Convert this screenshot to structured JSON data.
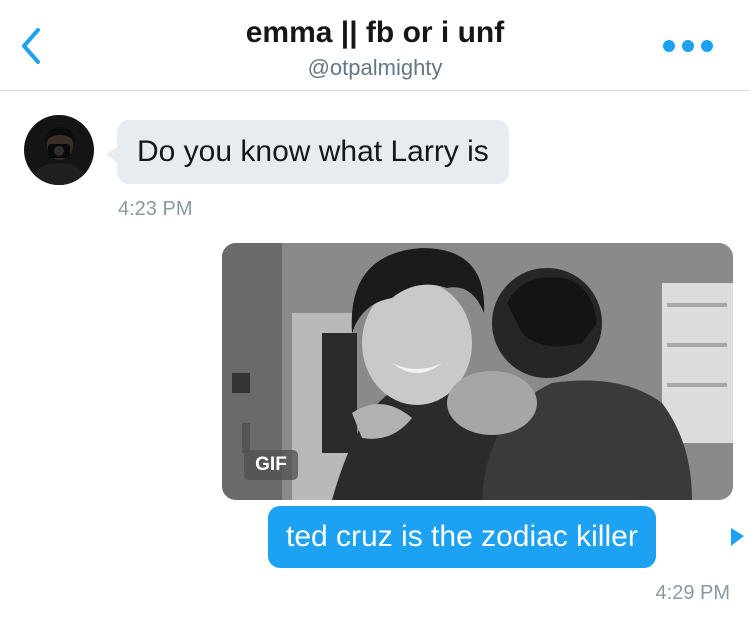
{
  "header": {
    "title": "emma || fb or i unf",
    "handle": "@otpalmighty",
    "back_icon": "chevron-left-icon",
    "more_icon": "more-dots-icon",
    "accent_color": "#1da1f2"
  },
  "messages": [
    {
      "direction": "incoming",
      "text": "Do you know what Larry is",
      "time": "4:23 PM"
    },
    {
      "direction": "outgoing",
      "media": "gif",
      "badge": "GIF"
    },
    {
      "direction": "outgoing",
      "text": "ted cruz is the zodiac killer",
      "time": "4:29 PM"
    }
  ],
  "colors": {
    "incoming_bubble": "#e6ecf0",
    "outgoing_bubble": "#1da1f2",
    "timestamp": "#8899a6"
  }
}
